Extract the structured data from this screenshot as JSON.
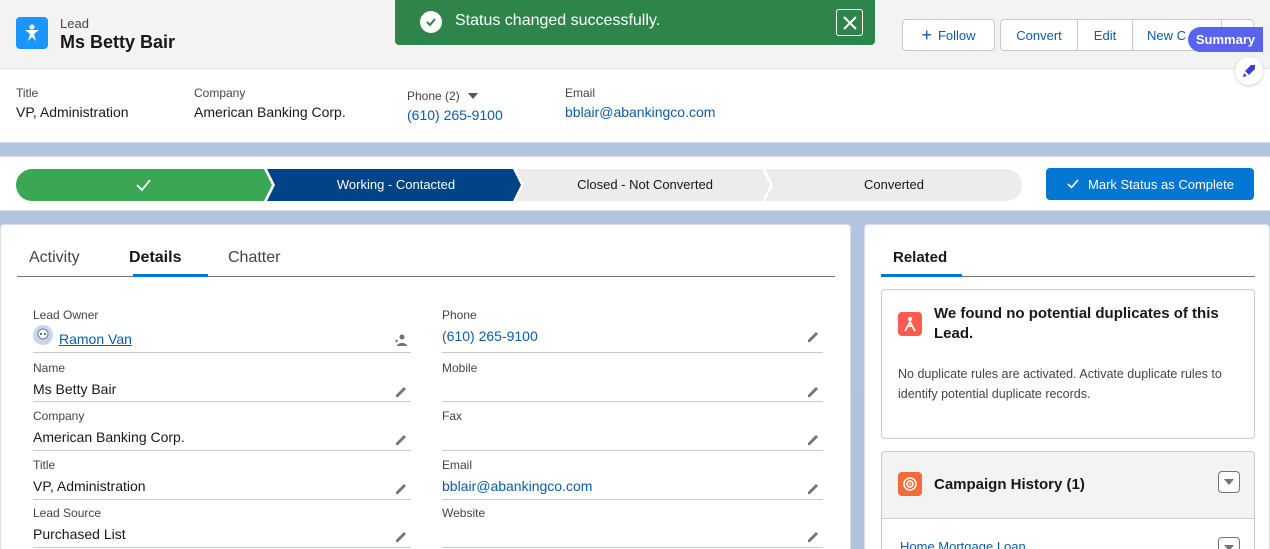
{
  "record": {
    "object_label": "Lead",
    "name": "Ms Betty Bair"
  },
  "toast": {
    "message": "Status changed successfully."
  },
  "actions": {
    "follow": "Follow",
    "convert": "Convert",
    "edit": "Edit",
    "new_case": "New C"
  },
  "summary": {
    "label": "Summary"
  },
  "highlights": [
    {
      "label": "Title",
      "value": "VP, Administration"
    },
    {
      "label": "Company",
      "value": "American Banking Corp."
    },
    {
      "label": "Phone (2)",
      "value": "(610) 265-9100"
    },
    {
      "label": "Email",
      "value": "bblair@abankingco.com"
    }
  ],
  "path": {
    "stages": [
      "",
      "Working - Contacted",
      "Closed - Not Converted",
      "Converted"
    ],
    "current_index": 1,
    "mark_button": "Mark Status as Complete",
    "colors": {
      "complete": "#3ba755",
      "current": "#014486",
      "incomplete": "#ececec"
    }
  },
  "tabs": [
    "Activity",
    "Details",
    "Chatter"
  ],
  "active_tab": "Details",
  "details": {
    "left": [
      {
        "label": "Lead Owner",
        "value": "Ramon Van"
      },
      {
        "label": "Name",
        "value": "Ms Betty Bair"
      },
      {
        "label": "Company",
        "value": "American Banking Corp."
      },
      {
        "label": "Title",
        "value": "VP, Administration"
      },
      {
        "label": "Lead Source",
        "value": "Purchased List"
      }
    ],
    "right": [
      {
        "label": "Phone",
        "value": "(610) 265-9100"
      },
      {
        "label": "Mobile",
        "value": ""
      },
      {
        "label": "Fax",
        "value": ""
      },
      {
        "label": "Email",
        "value": "bblair@abankingco.com"
      },
      {
        "label": "Website",
        "value": ""
      }
    ]
  },
  "related": {
    "tab": "Related",
    "duplicates": {
      "title": "We found no potential duplicates of this Lead.",
      "message": "No duplicate rules are activated. Activate duplicate rules to identify potential duplicate records."
    },
    "campaign": {
      "title": "Campaign History (1)",
      "item": "Home Mortgage Loan"
    }
  }
}
